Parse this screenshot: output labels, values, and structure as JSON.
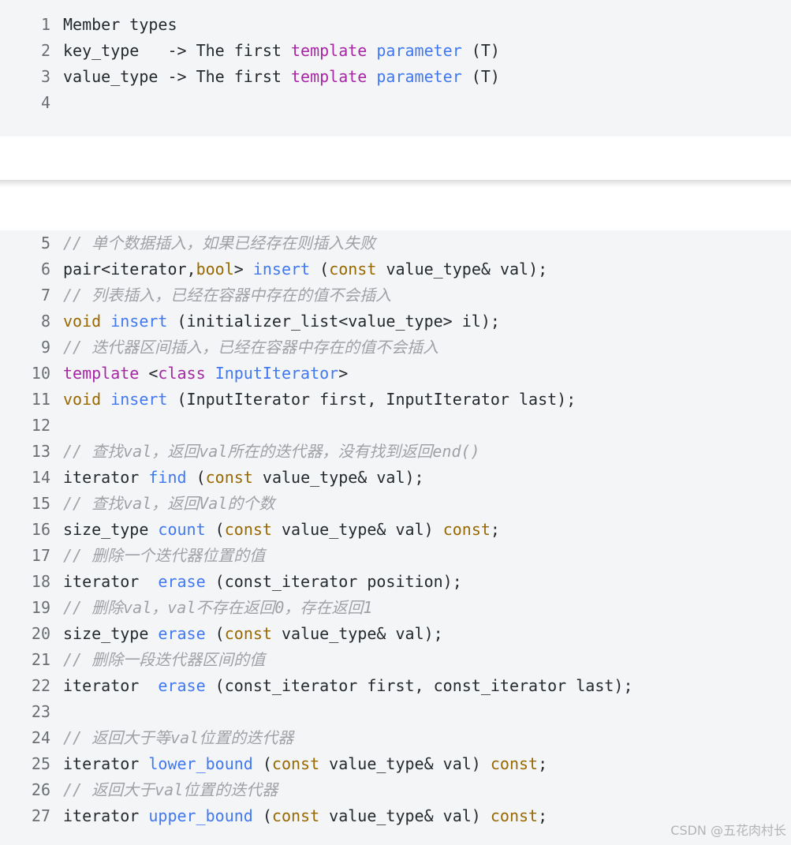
{
  "block1": {
    "lines": [
      {
        "n": "1",
        "tokens": [
          {
            "t": "Member types",
            "c": "plain"
          }
        ]
      },
      {
        "n": "2",
        "tokens": [
          {
            "t": "key_type   -> The first ",
            "c": "plain"
          },
          {
            "t": "template",
            "c": "kw"
          },
          {
            "t": " ",
            "c": "plain"
          },
          {
            "t": "parameter",
            "c": "fn"
          },
          {
            "t": " (T)",
            "c": "plain"
          }
        ]
      },
      {
        "n": "3",
        "tokens": [
          {
            "t": "value_type -> The first ",
            "c": "plain"
          },
          {
            "t": "template",
            "c": "kw"
          },
          {
            "t": " ",
            "c": "plain"
          },
          {
            "t": "parameter",
            "c": "fn"
          },
          {
            "t": " (T)",
            "c": "plain"
          }
        ]
      },
      {
        "n": "4",
        "tokens": []
      }
    ]
  },
  "block2": {
    "lines": [
      {
        "n": "5",
        "tokens": [
          {
            "t": "// 单个数据插入，如果已经存在则插入失败",
            "c": "cm"
          }
        ]
      },
      {
        "n": "6",
        "tokens": [
          {
            "t": "pair<iterator,",
            "c": "plain"
          },
          {
            "t": "bool",
            "c": "ty"
          },
          {
            "t": "> ",
            "c": "plain"
          },
          {
            "t": "insert",
            "c": "fn"
          },
          {
            "t": " (",
            "c": "plain"
          },
          {
            "t": "const",
            "c": "ty"
          },
          {
            "t": " value_type& val);",
            "c": "plain"
          }
        ]
      },
      {
        "n": "7",
        "tokens": [
          {
            "t": "// 列表插入，已经在容器中存在的值不会插入",
            "c": "cm"
          }
        ]
      },
      {
        "n": "8",
        "tokens": [
          {
            "t": "void",
            "c": "ty"
          },
          {
            "t": " ",
            "c": "plain"
          },
          {
            "t": "insert",
            "c": "fn"
          },
          {
            "t": " (initializer_list<value_type> il);",
            "c": "plain"
          }
        ]
      },
      {
        "n": "9",
        "tokens": [
          {
            "t": "// 迭代器区间插入，已经在容器中存在的值不会插入",
            "c": "cm"
          }
        ]
      },
      {
        "n": "10",
        "tokens": [
          {
            "t": "template",
            "c": "kw"
          },
          {
            "t": " <",
            "c": "plain"
          },
          {
            "t": "class",
            "c": "kw"
          },
          {
            "t": " ",
            "c": "plain"
          },
          {
            "t": "InputIterator",
            "c": "fn"
          },
          {
            "t": ">",
            "c": "plain"
          }
        ]
      },
      {
        "n": "11",
        "tokens": [
          {
            "t": "void",
            "c": "ty"
          },
          {
            "t": " ",
            "c": "plain"
          },
          {
            "t": "insert",
            "c": "fn"
          },
          {
            "t": " (InputIterator first, InputIterator last);",
            "c": "plain"
          }
        ]
      },
      {
        "n": "12",
        "tokens": []
      },
      {
        "n": "13",
        "tokens": [
          {
            "t": "// 查找val，返回val所在的迭代器，没有找到返回end()",
            "c": "cm"
          }
        ]
      },
      {
        "n": "14",
        "tokens": [
          {
            "t": "iterator ",
            "c": "plain"
          },
          {
            "t": "find",
            "c": "fn"
          },
          {
            "t": " (",
            "c": "plain"
          },
          {
            "t": "const",
            "c": "ty"
          },
          {
            "t": " value_type& val);",
            "c": "plain"
          }
        ]
      },
      {
        "n": "15",
        "tokens": [
          {
            "t": "// 查找val，返回Val的个数",
            "c": "cm"
          }
        ]
      },
      {
        "n": "16",
        "tokens": [
          {
            "t": "size_type ",
            "c": "plain"
          },
          {
            "t": "count",
            "c": "fn"
          },
          {
            "t": " (",
            "c": "plain"
          },
          {
            "t": "const",
            "c": "ty"
          },
          {
            "t": " value_type& val) ",
            "c": "plain"
          },
          {
            "t": "const",
            "c": "ty"
          },
          {
            "t": ";",
            "c": "plain"
          }
        ]
      },
      {
        "n": "17",
        "tokens": [
          {
            "t": "// 删除一个迭代器位置的值",
            "c": "cm"
          }
        ]
      },
      {
        "n": "18",
        "tokens": [
          {
            "t": "iterator  ",
            "c": "plain"
          },
          {
            "t": "erase",
            "c": "fn"
          },
          {
            "t": " (const_iterator position);",
            "c": "plain"
          }
        ]
      },
      {
        "n": "19",
        "tokens": [
          {
            "t": "// 删除val，val不存在返回0，存在返回1",
            "c": "cm"
          }
        ]
      },
      {
        "n": "20",
        "tokens": [
          {
            "t": "size_type ",
            "c": "plain"
          },
          {
            "t": "erase",
            "c": "fn"
          },
          {
            "t": " (",
            "c": "plain"
          },
          {
            "t": "const",
            "c": "ty"
          },
          {
            "t": " value_type& val);",
            "c": "plain"
          }
        ]
      },
      {
        "n": "21",
        "tokens": [
          {
            "t": "// 删除一段迭代器区间的值",
            "c": "cm"
          }
        ]
      },
      {
        "n": "22",
        "tokens": [
          {
            "t": "iterator  ",
            "c": "plain"
          },
          {
            "t": "erase",
            "c": "fn"
          },
          {
            "t": " (const_iterator first, const_iterator last);",
            "c": "plain"
          }
        ]
      },
      {
        "n": "23",
        "tokens": []
      },
      {
        "n": "24",
        "tokens": [
          {
            "t": "// 返回大于等val位置的迭代器",
            "c": "cm"
          }
        ]
      },
      {
        "n": "25",
        "tokens": [
          {
            "t": "iterator ",
            "c": "plain"
          },
          {
            "t": "lower_bound",
            "c": "fn"
          },
          {
            "t": " (",
            "c": "plain"
          },
          {
            "t": "const",
            "c": "ty"
          },
          {
            "t": " value_type& val) ",
            "c": "plain"
          },
          {
            "t": "const",
            "c": "ty"
          },
          {
            "t": ";",
            "c": "plain"
          }
        ]
      },
      {
        "n": "26",
        "tokens": [
          {
            "t": "// 返回大于val位置的迭代器",
            "c": "cm"
          }
        ]
      },
      {
        "n": "27",
        "tokens": [
          {
            "t": "iterator ",
            "c": "plain"
          },
          {
            "t": "upper_bound",
            "c": "fn"
          },
          {
            "t": " (",
            "c": "plain"
          },
          {
            "t": "const",
            "c": "ty"
          },
          {
            "t": " value_type& val) ",
            "c": "plain"
          },
          {
            "t": "const",
            "c": "ty"
          },
          {
            "t": ";",
            "c": "plain"
          }
        ]
      }
    ]
  },
  "watermark": "CSDN @五花肉村长",
  "colors": {
    "keyword": "#a626a4",
    "function": "#4078f2",
    "type": "#986801",
    "comment": "#a0a1a7",
    "code_background": "#f4f5f7"
  }
}
